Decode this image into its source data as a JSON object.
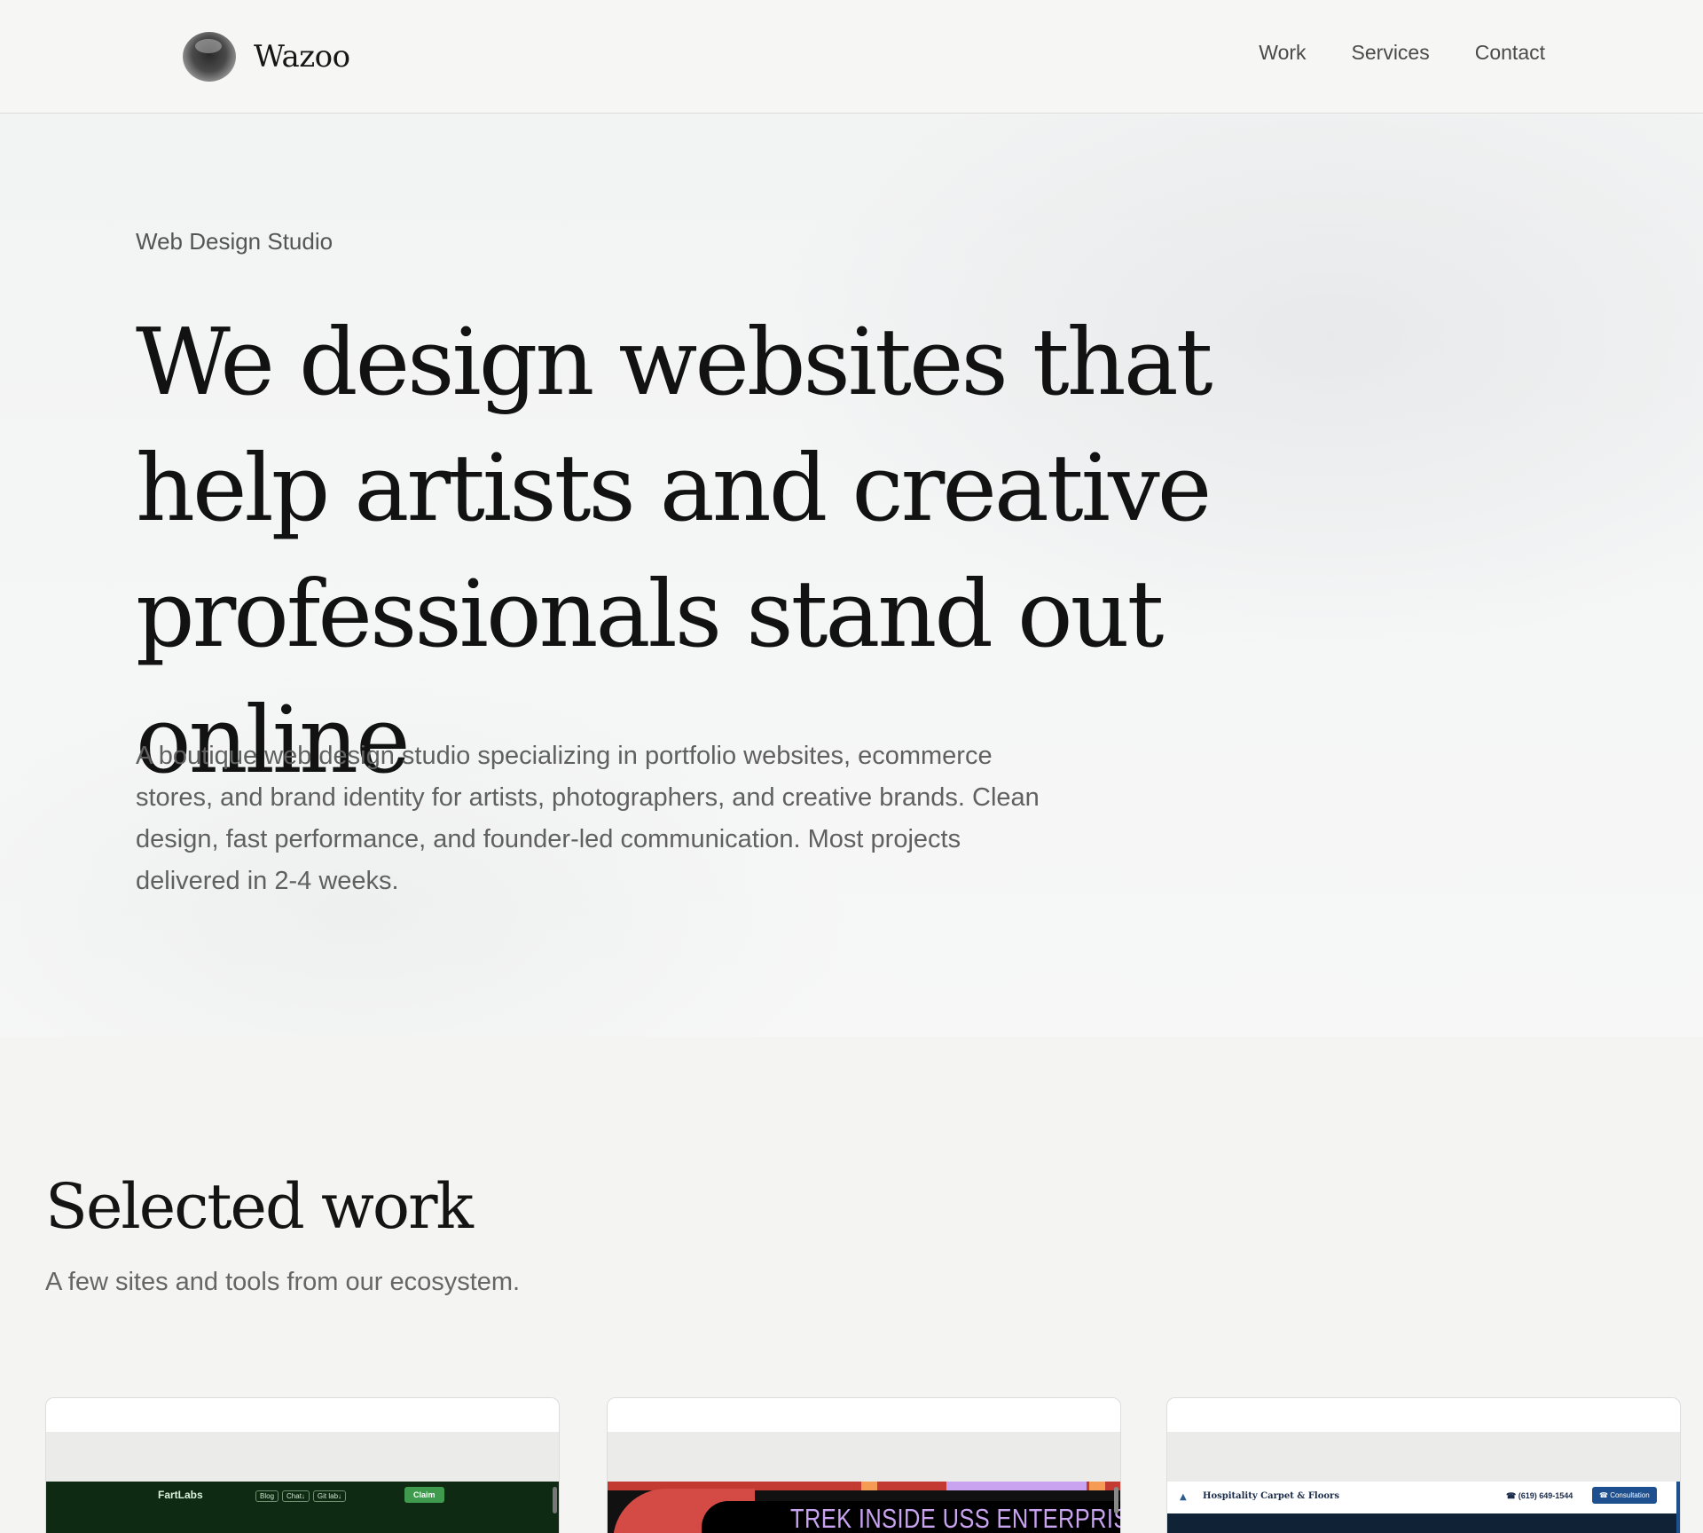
{
  "header": {
    "brand": "Wazoo",
    "nav": [
      "Work",
      "Services",
      "Contact"
    ]
  },
  "hero": {
    "eyebrow": "Web Design Studio",
    "headline": "We design websites that help artists and creative professionals stand out online",
    "lede": "A boutique web design studio specializing in portfolio websites, ecommerce stores, and brand identity for artists, photographers, and creative brands. Clean design, fast performance, and founder-led communication. Most projects delivered in 2-4 weeks."
  },
  "work": {
    "title": "Selected work",
    "subtitle": "A few sites and tools from our ecosystem.",
    "cards": [
      {
        "site_logo": "FartLabs",
        "pills": [
          "Blog",
          "Chat↓",
          "Git lab↓"
        ],
        "cta": "Claim",
        "theme_color": "#0e2a12"
      },
      {
        "banner_text": "TREK INSIDE USS ENTERPRISE-D",
        "theme_color": "#c9a3f0"
      },
      {
        "site_name": "Hospitality Carpet & Floors",
        "phone": "☎ (619) 649-1544",
        "cta": "☎ Consultation",
        "theme_color": "#1e4f8e"
      }
    ]
  }
}
